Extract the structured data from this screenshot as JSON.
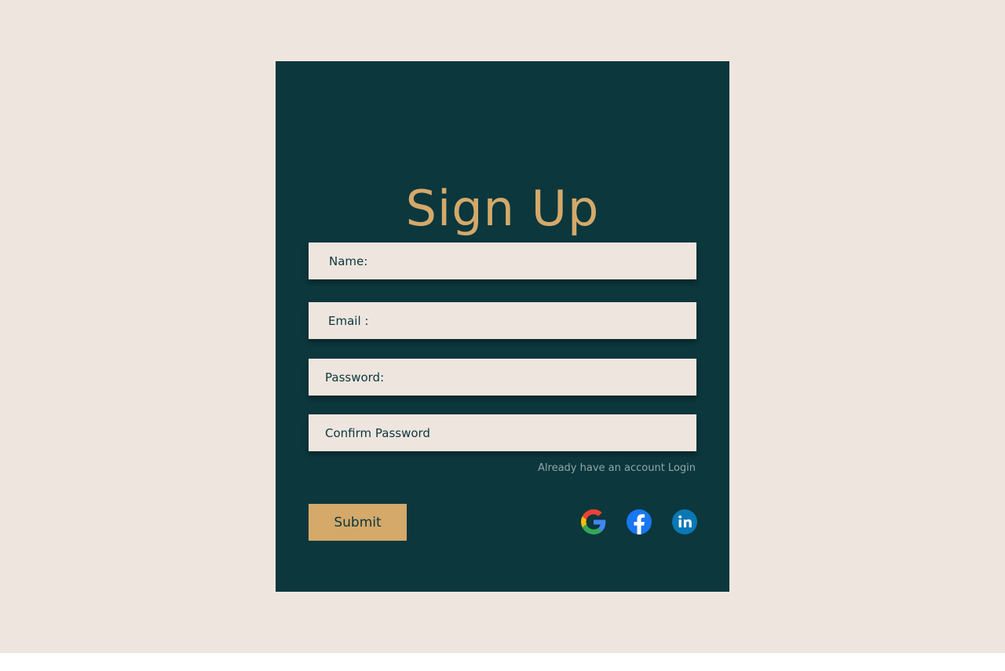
{
  "form": {
    "title": "Sign Up",
    "fields": {
      "name_placeholder": "Name:",
      "email_placeholder": "Email :",
      "password_placeholder": "Password:",
      "confirm_placeholder": "Confirm Password"
    },
    "login_link": "Already have an account Login",
    "submit_label": "Submit"
  },
  "social": [
    {
      "icon": "google-icon"
    },
    {
      "icon": "facebook-icon"
    },
    {
      "icon": "linkedin-icon"
    }
  ],
  "colors": {
    "background": "#efe5df",
    "card": "#0b373d",
    "accent": "#d4a96a",
    "field_bg": "#efe5df",
    "muted_text": "#93a7a8"
  }
}
